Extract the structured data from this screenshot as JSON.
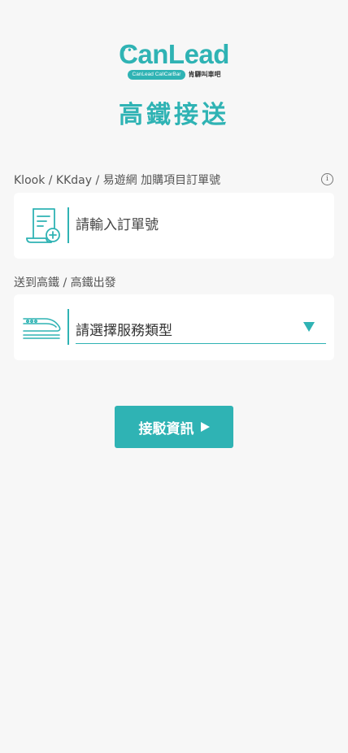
{
  "brand": {
    "logo_text": "CanLead",
    "logo_pill": "CanLead CallCarBar",
    "logo_cn": "肯驛叫車吧",
    "accent_color": "#2fb3b4"
  },
  "page": {
    "title": "高鐵接送"
  },
  "order_section": {
    "label": "Klook / KKday / 易遊網 加購項目訂單號",
    "info_icon": "info-icon",
    "input_placeholder": "請輸入訂單號",
    "input_value": "",
    "icon": "document-add-icon"
  },
  "service_section": {
    "label": "送到高鐵 / 高鐵出發",
    "select_value": "請選擇服務類型",
    "icon": "high-speed-train-icon",
    "dropdown_icon": "caret-down-icon"
  },
  "actions": {
    "pickup_info_label": "接駁資訊"
  }
}
